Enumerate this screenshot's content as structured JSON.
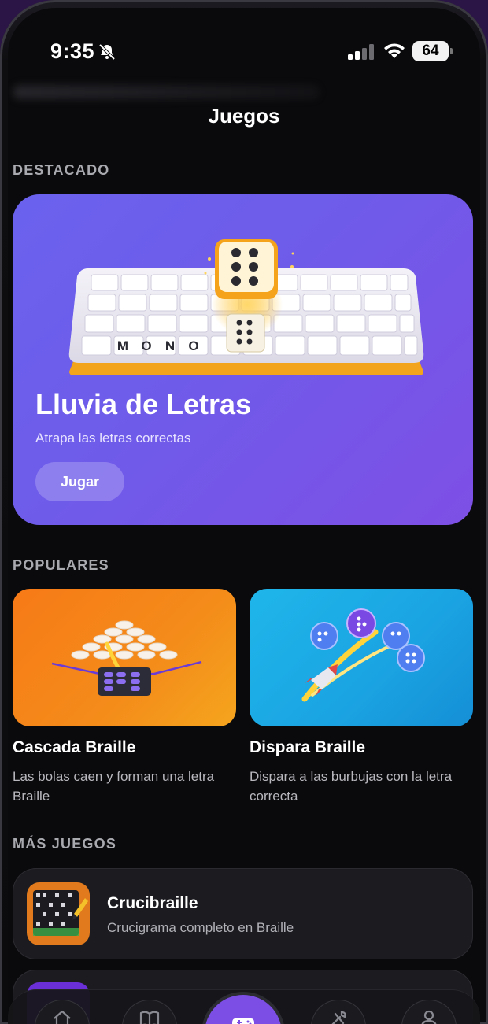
{
  "status_bar": {
    "time": "9:35",
    "battery": "64"
  },
  "header": {
    "title": "Juegos"
  },
  "sections": {
    "featured": "DESTACADO",
    "popular": "POPULARES",
    "more": "MÁS JUEGOS"
  },
  "featured": {
    "title": "Lluvia de Letras",
    "subtitle": "Atrapa las letras correctas",
    "button": "Jugar",
    "board_word": [
      "M",
      "O",
      "N",
      "O"
    ]
  },
  "popular": [
    {
      "title": "Cascada Braille",
      "description": "Las bolas caen y forman una letra Braille"
    },
    {
      "title": "Dispara Braille",
      "description": "Dispara a las burbujas con la letra correcta"
    }
  ],
  "more_games": [
    {
      "title": "Crucibraille",
      "subtitle": "Crucigrama completo en Braille"
    }
  ],
  "tabs": [
    {
      "icon": "home-icon"
    },
    {
      "icon": "book-icon"
    },
    {
      "icon": "gamepad-icon",
      "active": true
    },
    {
      "icon": "tools-icon"
    },
    {
      "icon": "profile-icon"
    }
  ],
  "colors": {
    "accent": "#7d4ee6",
    "featured_bg": "#6f5bea",
    "orange_card": "#f48c1a",
    "blue_card": "#1aa3e2"
  }
}
